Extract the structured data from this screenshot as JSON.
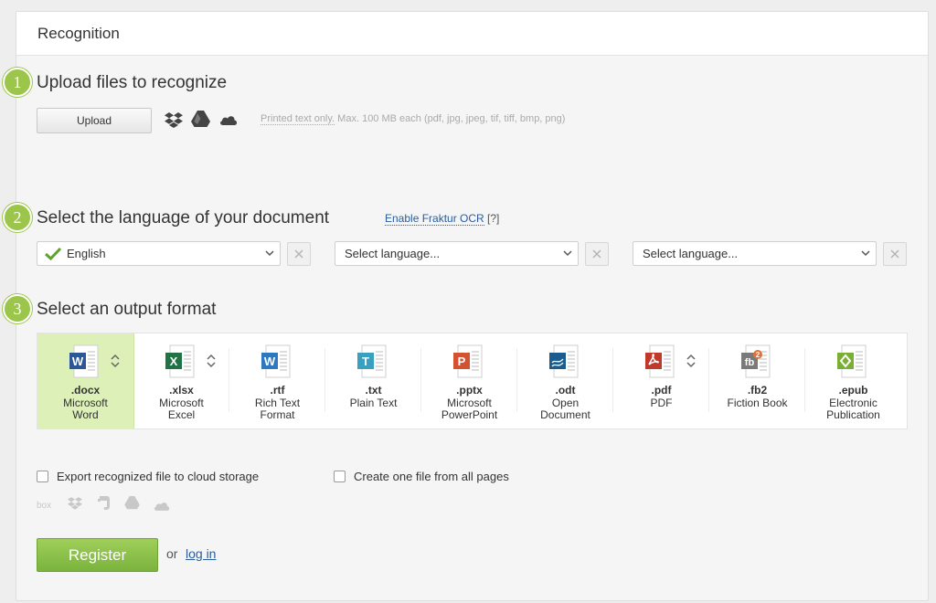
{
  "panel": {
    "title": "Recognition"
  },
  "steps": [
    {
      "number": "1",
      "title": "Upload files to recognize"
    },
    {
      "number": "2",
      "title": "Select the language of your document"
    },
    {
      "number": "3",
      "title": "Select an output format"
    }
  ],
  "upload": {
    "button_label": "Upload",
    "sources": [
      "dropbox-icon",
      "google-drive-icon",
      "onedrive-icon"
    ],
    "hint_underlined": "Printed text only.",
    "hint_rest": " Max. 100 MB each (pdf, jpg, jpeg, tif, tiff, bmp, png)"
  },
  "language": {
    "fraktur_link": "Enable Fraktur OCR",
    "fraktur_help": "[?]",
    "selects": [
      {
        "value": "English",
        "checked": true
      },
      {
        "value": "Select language...",
        "checked": false
      },
      {
        "value": "Select language...",
        "checked": false
      }
    ]
  },
  "formats": [
    {
      "ext": ".docx",
      "name": "Microsoft Word",
      "letter": "W",
      "color": "#2b5797",
      "selected": true,
      "has_options": true
    },
    {
      "ext": ".xlsx",
      "name": "Microsoft Excel",
      "letter": "X",
      "color": "#217346",
      "selected": false,
      "has_options": true
    },
    {
      "ext": ".rtf",
      "name": "Rich Text Format",
      "letter": "W",
      "color": "#2e78c2",
      "selected": false,
      "has_options": false
    },
    {
      "ext": ".txt",
      "name": "Plain Text",
      "letter": "T",
      "color": "#3aa0c0",
      "selected": false,
      "has_options": false
    },
    {
      "ext": ".pptx",
      "name": "Microsoft PowerPoint",
      "letter": "P",
      "color": "#d35230",
      "selected": false,
      "has_options": false
    },
    {
      "ext": ".odt",
      "name": "Open Document",
      "letter": "",
      "color": "#1b5c8e",
      "selected": false,
      "has_options": false
    },
    {
      "ext": ".pdf",
      "name": "PDF",
      "letter": "",
      "color": "#c0392b",
      "selected": false,
      "has_options": true
    },
    {
      "ext": ".fb2",
      "name": "Fiction Book",
      "letter": "fb",
      "color": "#7a7a7a",
      "selected": false,
      "has_options": false
    },
    {
      "ext": ".epub",
      "name": "Electronic Publication",
      "letter": "",
      "color": "#79b033",
      "selected": false,
      "has_options": false
    }
  ],
  "options": {
    "export_cloud": "Export recognized file to cloud storage",
    "one_file": "Create one file from all pages",
    "cloud_targets": [
      "box-icon",
      "dropbox-icon",
      "evernote-icon",
      "google-drive-icon",
      "onedrive-icon"
    ]
  },
  "footer": {
    "register_label": "Register",
    "or_text": "or",
    "login_label": "log in"
  },
  "colors": {
    "accent": "#9cc54c",
    "link": "#2a5d9c",
    "selected_bg": "#dcf0b8"
  }
}
